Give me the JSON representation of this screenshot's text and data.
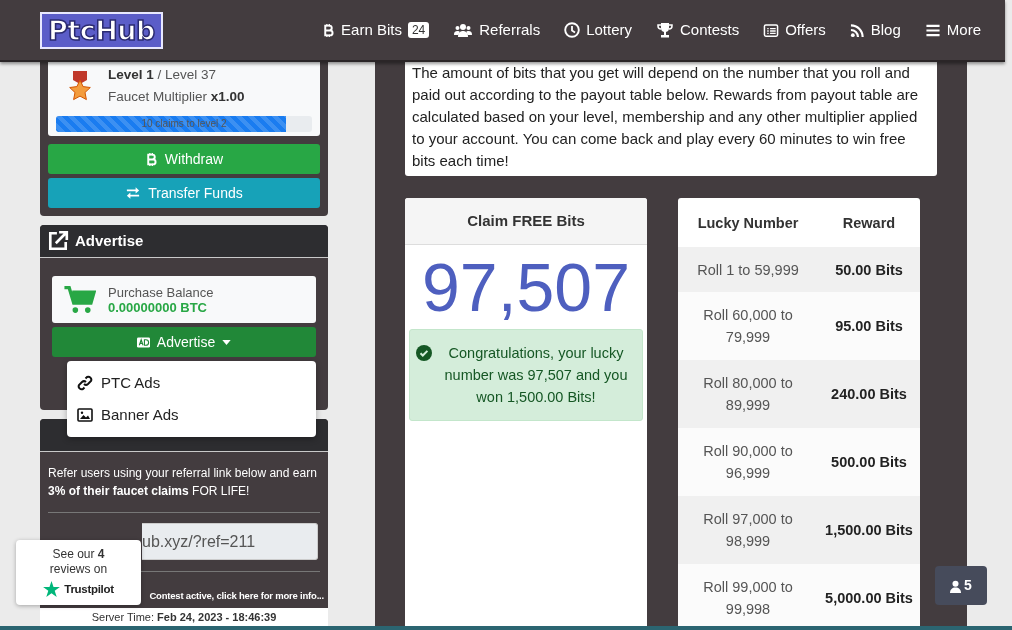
{
  "navbar": {
    "logo": "PtcHub",
    "items": [
      {
        "label": "Earn Bits",
        "badge": "24"
      },
      {
        "label": "Referrals"
      },
      {
        "label": "Lottery"
      },
      {
        "label": "Contests"
      },
      {
        "label": "Offers"
      },
      {
        "label": "Blog"
      },
      {
        "label": "More"
      }
    ]
  },
  "level_card": {
    "level": "Level 1",
    "max_level": "/ Level 37",
    "multiplier_label": "Faucet Multiplier",
    "multiplier": "x1.00",
    "progress": {
      "level": 0.9,
      "text": "10 claims to level 2"
    }
  },
  "account_buttons": [
    "Withdraw",
    "Transfer Funds"
  ],
  "advertise": {
    "title": "Advertise",
    "balance_label": "Purchase Balance",
    "balance": "0.00000000 BTC",
    "dropdown": {
      "label": "Advertise",
      "expanded": true,
      "items": [
        "PTC Ads",
        "Banner Ads"
      ]
    }
  },
  "referral": {
    "text": "Refer users using your referral link below and earn **3% of their faucet claims** FOR LIFE!",
    "link_value": "ub.xyz/?ref=211"
  },
  "contest_notice": "Contest active, click here for more info...",
  "server_time": {
    "label": "Server Time:",
    "value": "Feb 24, 2023 - 18:46:39"
  },
  "trustpilot": {
    "text": "See our **4** reviews on",
    "brand": "Trustpilot"
  },
  "intro_text": "The amount of bits that you get will depend on the number that you roll and paid out according to the payout table below. Rewards from payout table are calculated based on your level, membership and any other multiplier applied to your account. You can come back and play every 60 minutes to win free bits each time!",
  "claim": {
    "title": "Claim FREE Bits",
    "number": "97,507",
    "message": "Congratulations, your lucky number was 97,507 and you won 1,500.00 Bits!"
  },
  "payout_table": {
    "columns": [
      "Lucky Number",
      "Reward"
    ],
    "rows": [
      {
        "range": "Roll 1 to 59,999",
        "reward": "50.00 Bits"
      },
      {
        "range": "Roll 60,000 to 79,999",
        "reward": "95.00 Bits"
      },
      {
        "range": "Roll 80,000 to 89,999",
        "reward": "240.00 Bits"
      },
      {
        "range": "Roll 90,000 to 96,999",
        "reward": "500.00 Bits"
      },
      {
        "range": "Roll 97,000 to 98,999",
        "reward": "1,500.00 Bits"
      },
      {
        "range": "Roll 99,000 to 99,998",
        "reward": "5,000.00 Bits"
      }
    ]
  },
  "online_users": "5"
}
